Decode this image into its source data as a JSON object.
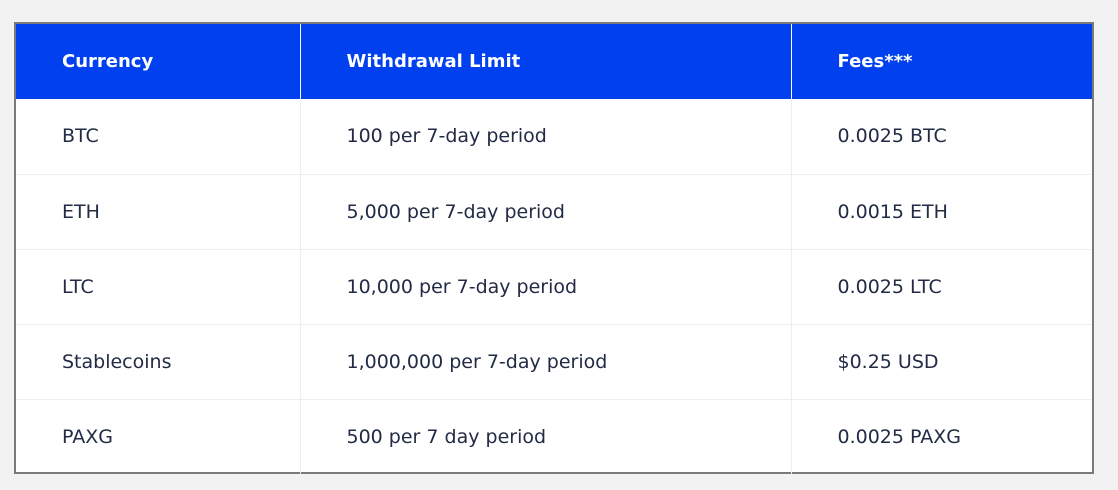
{
  "table": {
    "headers": [
      "Currency",
      "Withdrawal Limit",
      "Fees***"
    ],
    "rows": [
      [
        "BTC",
        "100 per 7-day period",
        "0.0025 BTC"
      ],
      [
        "ETH",
        "5,000 per 7-day period",
        "0.0015 ETH"
      ],
      [
        "LTC",
        "10,000 per 7-day period",
        "0.0025 LTC"
      ],
      [
        "Stablecoins",
        "1,000,000 per 7-day period",
        "$0.25 USD"
      ],
      [
        "PAXG",
        "500 per 7 day period",
        "0.0025 PAXG"
      ]
    ]
  },
  "colors": {
    "header_background": "#0040ef",
    "header_text": "#ffffff",
    "cell_text": "#222b45",
    "frame_border": "#7a7a7a",
    "page_background": "#f2f2f2"
  }
}
